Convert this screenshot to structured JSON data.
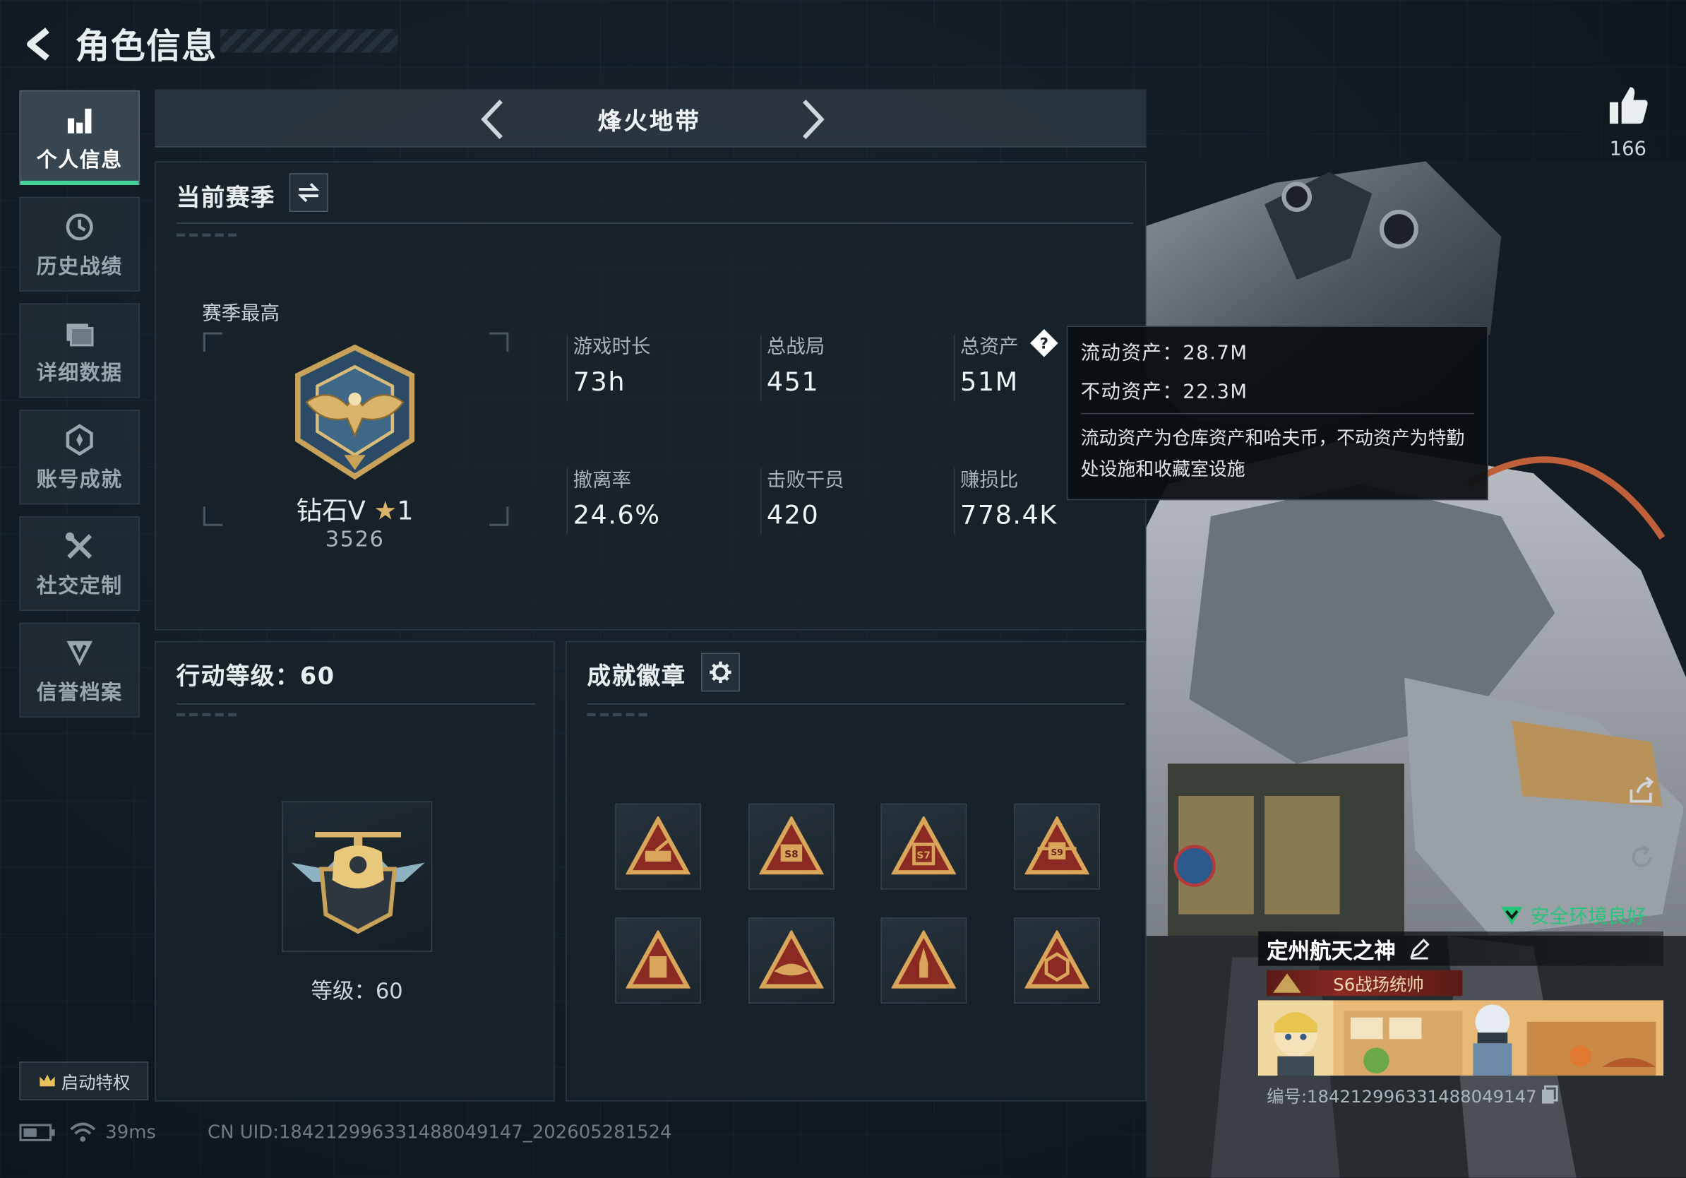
{
  "header": {
    "title": "角色信息"
  },
  "sidebar": {
    "items": [
      {
        "label": "个人信息",
        "icon": "bar-chart-icon"
      },
      {
        "label": "历史战绩",
        "icon": "history-clock-icon"
      },
      {
        "label": "详细数据",
        "icon": "folder-data-icon"
      },
      {
        "label": "账号成就",
        "icon": "achievement-icon"
      },
      {
        "label": "社交定制",
        "icon": "tools-icon"
      },
      {
        "label": "信誉档案",
        "icon": "credit-shield-icon"
      }
    ],
    "privilege_label": "启动特权"
  },
  "mode": {
    "title": "烽火地带"
  },
  "season": {
    "title": "当前赛季",
    "peak_label": "赛季最高",
    "rank_name": "钻石V",
    "rank_stars": "1",
    "rank_score": "3526",
    "stats": [
      {
        "label": "游戏时长",
        "value": "73h"
      },
      {
        "label": "总战局",
        "value": "451"
      },
      {
        "label": "总资产",
        "value": "51M"
      },
      {
        "label": "撤离率",
        "value": "24.6%"
      },
      {
        "label": "击败干员",
        "value": "420"
      },
      {
        "label": "赚损比",
        "value": "778.4K"
      }
    ]
  },
  "tooltip": {
    "liquid": "流动资产：28.7M",
    "fixed": "不动资产：22.3M",
    "desc": "流动资产为仓库资产和哈夫币，不动资产为特勤处设施和收藏室设施"
  },
  "action_level": {
    "title": "行动等级：60",
    "level_text": "等级：60",
    "level": 60
  },
  "achievements": {
    "title": "成就徽章",
    "badge_count": 8
  },
  "like": {
    "count": "166"
  },
  "profile": {
    "name": "定州航天之神",
    "title": "S6战场统帅",
    "uid": "编号:184212996331488049147"
  },
  "safe_env": "安全环境良好",
  "status": {
    "ping": "39ms",
    "uid_line": "CN UID:184212996331488049147_202605281524"
  },
  "colors": {
    "accent_green": "#42d49a",
    "gold": "#c9a25a",
    "safe_green": "#26c57c"
  }
}
